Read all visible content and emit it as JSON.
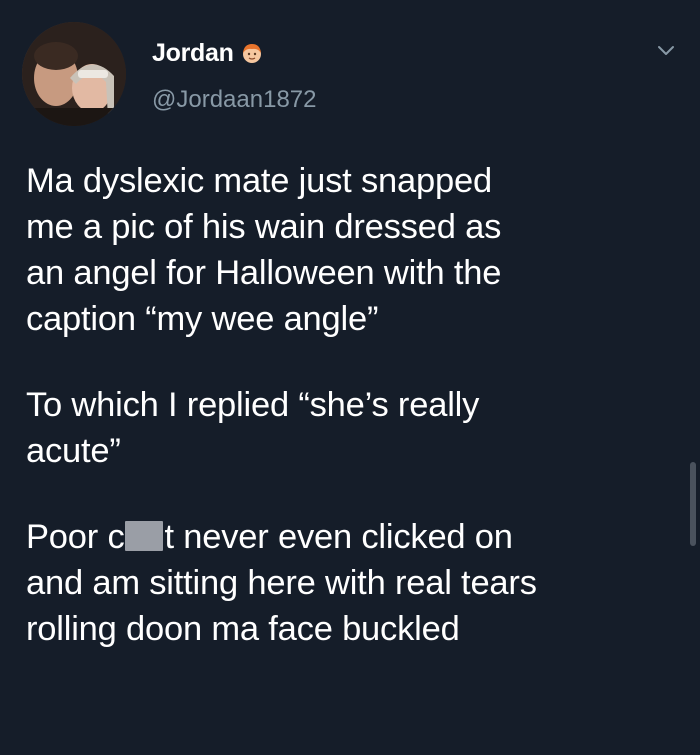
{
  "user": {
    "display_name": "Jordan",
    "handle": "@Jordaan1872",
    "name_emoji": "red-haired-person-emoji"
  },
  "tweet": {
    "lines_p1": [
      "Ma dyslexic mate just snapped",
      "me a pic of his wain dressed as",
      "an angel for Halloween with the",
      "caption “my wee angle”"
    ],
    "lines_p2": [
      "To which I replied “she’s really",
      "acute”"
    ],
    "p3_line1_before": "Poor c",
    "p3_line1_after": "t never even clicked on",
    "lines_p3_rest": [
      "and am sitting here with real tears",
      "rolling doon ma face buckled"
    ]
  },
  "icons": {
    "menu": "chevron-down-icon"
  },
  "colors": {
    "background": "#151d29",
    "text": "#ffffff",
    "handle": "#8899a6",
    "redaction": "#9a9ea6"
  }
}
